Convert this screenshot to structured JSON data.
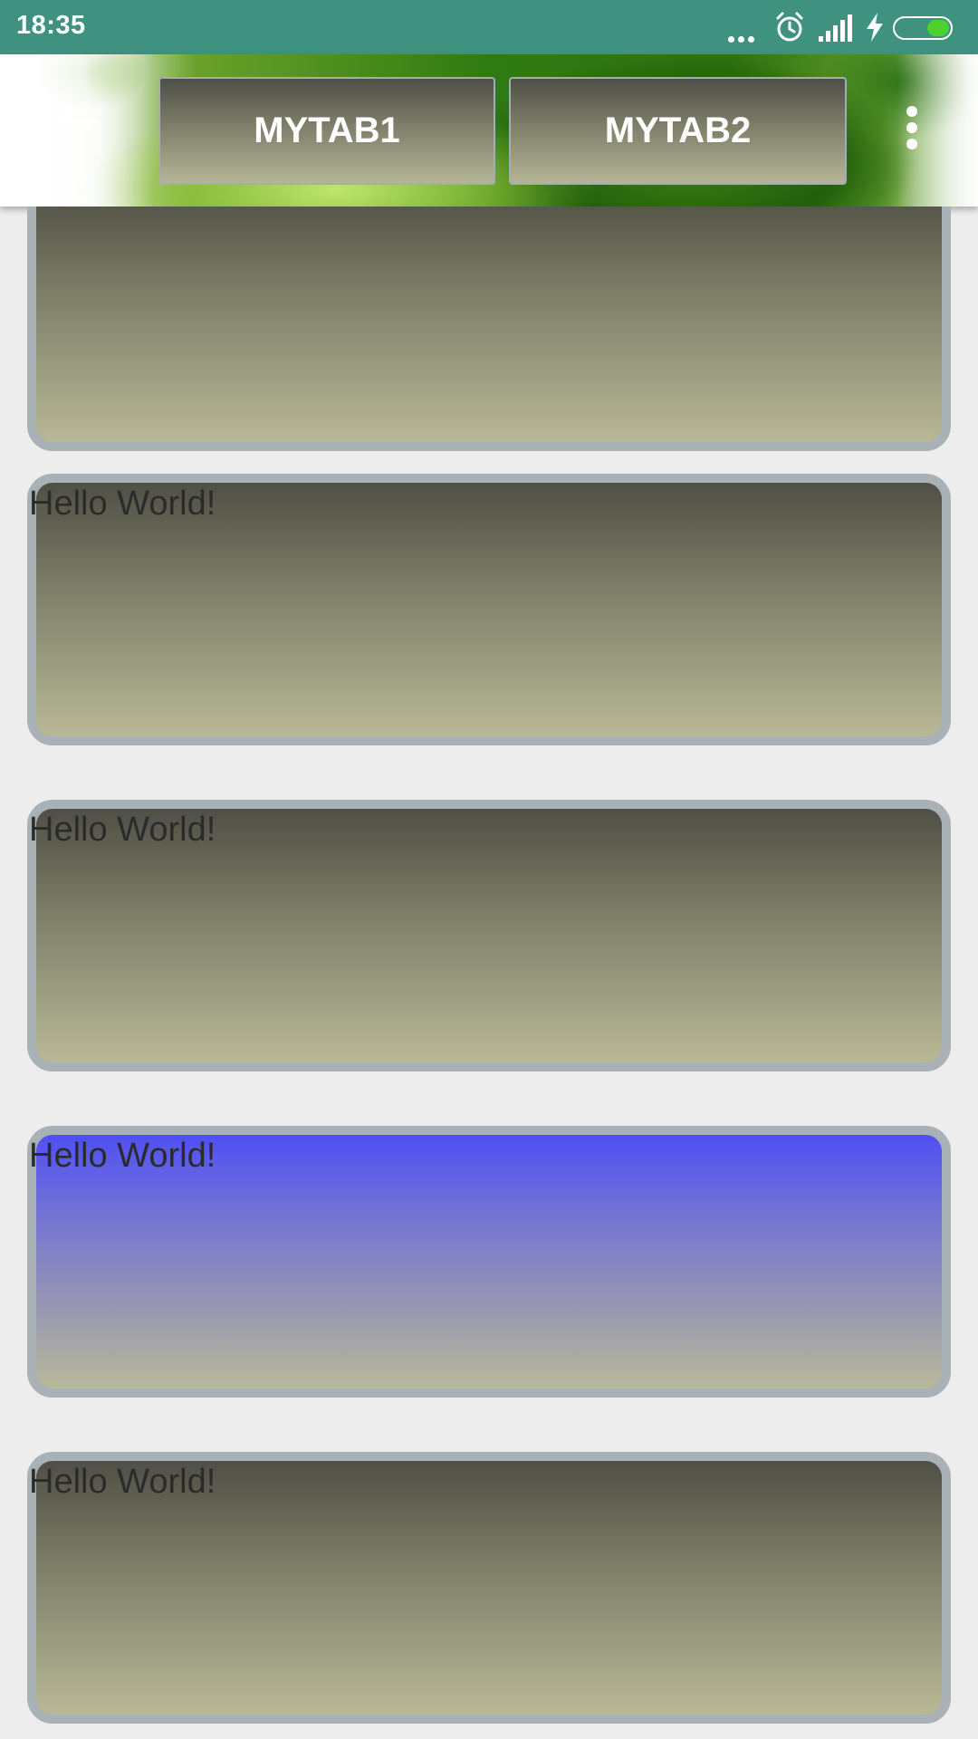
{
  "status_bar": {
    "time": "18:35"
  },
  "app_bar": {
    "tabs": [
      {
        "label": "MYTAB1"
      },
      {
        "label": "MYTAB2"
      }
    ]
  },
  "cards": [
    {
      "text": ""
    },
    {
      "text": "Hello World!"
    },
    {
      "text": "Hello World!"
    },
    {
      "text": "Hello World!"
    },
    {
      "text": "Hello World!"
    }
  ],
  "colors": {
    "status_bar_bg": "#3f9280",
    "card_border": "#a8b2b6",
    "card_gradient_top": "#4f4f45",
    "card_gradient_bottom": "#b8b897",
    "highlight_gradient_top": "#4f4ff5",
    "battery_fill": "#4cd12d",
    "page_background": "#ededed"
  }
}
